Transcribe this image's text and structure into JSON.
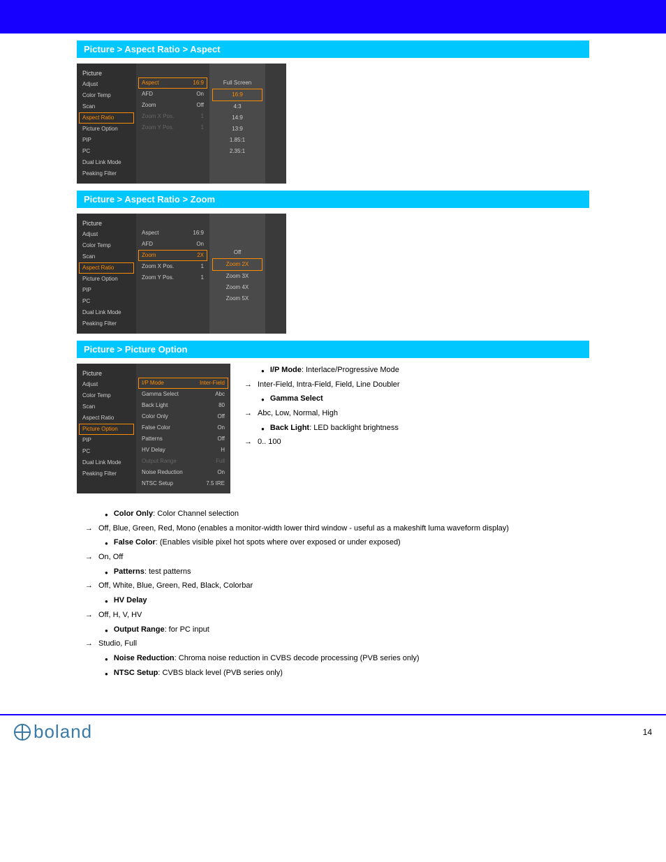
{
  "sections": {
    "aspect": {
      "title": "Picture > Aspect Ratio > Aspect",
      "menu_header": "Picture",
      "col1": [
        {
          "label": "Adjust"
        },
        {
          "label": "Color Temp"
        },
        {
          "label": "Scan"
        },
        {
          "label": "Aspect Ratio",
          "selected": true,
          "highlight": true
        },
        {
          "label": "Picture Option"
        },
        {
          "label": "PIP"
        },
        {
          "label": "PC"
        },
        {
          "label": "Dual Link Mode"
        },
        {
          "label": "Peaking Filter"
        }
      ],
      "col2": [
        {
          "label": "Aspect",
          "value": "16:9",
          "selected": true,
          "highlight": true
        },
        {
          "label": "AFD",
          "value": "On"
        },
        {
          "label": "Zoom",
          "value": "Off"
        },
        {
          "label": "Zoom X Pos.",
          "value": "1",
          "disabled": true
        },
        {
          "label": "Zoom Y Pos.",
          "value": "1",
          "disabled": true
        }
      ],
      "col3": [
        {
          "label": "Full Screen"
        },
        {
          "label": "16:9",
          "selected": true
        },
        {
          "label": "4:3"
        },
        {
          "label": "14:9"
        },
        {
          "label": "13:9"
        },
        {
          "label": "1.85:1"
        },
        {
          "label": "2.35:1"
        }
      ]
    },
    "zoom": {
      "title": "Picture > Aspect Ratio > Zoom",
      "menu_header": "Picture",
      "col1": [
        {
          "label": "Adjust"
        },
        {
          "label": "Color Temp"
        },
        {
          "label": "Scan"
        },
        {
          "label": "Aspect Ratio",
          "selected": true,
          "highlight": true
        },
        {
          "label": "Picture Option"
        },
        {
          "label": "PIP"
        },
        {
          "label": "PC"
        },
        {
          "label": "Dual Link Mode"
        },
        {
          "label": "Peaking Filter"
        }
      ],
      "col2": [
        {
          "label": "Aspect",
          "value": "16:9"
        },
        {
          "label": "AFD",
          "value": "On"
        },
        {
          "label": "Zoom",
          "value": "2X",
          "selected": true,
          "highlight": true
        },
        {
          "label": "Zoom X Pos.",
          "value": "1"
        },
        {
          "label": "Zoom Y Pos.",
          "value": "1"
        }
      ],
      "col3": [
        {
          "label": "Off"
        },
        {
          "label": "Zoom 2X",
          "selected": true
        },
        {
          "label": "Zoom 3X"
        },
        {
          "label": "Zoom 4X"
        },
        {
          "label": "Zoom 5X"
        }
      ]
    },
    "picopt": {
      "title": "Picture > Picture Option",
      "menu_header": "Picture",
      "col1": [
        {
          "label": "Adjust"
        },
        {
          "label": "Color Temp"
        },
        {
          "label": "Scan"
        },
        {
          "label": "Aspect Ratio"
        },
        {
          "label": "Picture Option",
          "selected": true,
          "highlight": true
        },
        {
          "label": "PIP"
        },
        {
          "label": "PC"
        },
        {
          "label": "Dual Link Mode"
        },
        {
          "label": "Peaking Filter"
        }
      ],
      "col2": [
        {
          "label": "I/P Mode",
          "value": "Inter-Field",
          "selected": true,
          "highlight": true
        },
        {
          "label": "Gamma Select",
          "value": "Abc"
        },
        {
          "label": "Back Light",
          "value": "80"
        },
        {
          "label": "Color Only",
          "value": "Off"
        },
        {
          "label": "False Color",
          "value": "On"
        },
        {
          "label": "Patterns",
          "value": "Off"
        },
        {
          "label": "HV Delay",
          "value": "H"
        },
        {
          "label": "Output Range",
          "value": "Full",
          "disabled": true
        },
        {
          "label": "Noise Reduction",
          "value": "On"
        },
        {
          "label": "NTSC Setup",
          "value": "7.5 IRE"
        }
      ],
      "side_bullets": [
        {
          "bold": "I/P Mode",
          "tail": ": Interlace/Progressive Mode"
        },
        {
          "arrow": true,
          "text": "Inter-Field, Intra-Field, Field, Line Doubler"
        },
        {
          "bold": "Gamma Select"
        },
        {
          "arrow": true,
          "text": "Abc, Low, Normal, High"
        },
        {
          "bold": "Back Light",
          "tail": ": LED backlight brightness"
        },
        {
          "arrow": true,
          "text": "0.. 100"
        }
      ],
      "below_bullets": [
        {
          "bold": "Color Only",
          "tail": ": Color Channel selection"
        },
        {
          "arrow": true,
          "text": "Off, Blue, Green, Red, Mono (enables a monitor-width lower third window - useful as a makeshift luma waveform display)"
        },
        {
          "bold": "False Color",
          "tail": ": (Enables visible pixel hot spots where over exposed or under exposed)"
        },
        {
          "arrow": true,
          "text": "On, Off"
        },
        {
          "bold": "Patterns",
          "tail": ": test patterns"
        },
        {
          "arrow": true,
          "text": "Off, White, Blue, Green, Red, Black, Colorbar"
        },
        {
          "bold": "HV Delay"
        },
        {
          "arrow": true,
          "text": "Off, H, V, HV"
        },
        {
          "bold": "Output Range",
          "tail": ": for PC input"
        },
        {
          "arrow": true,
          "text": "Studio, Full"
        },
        {
          "bold": "Noise Reduction",
          "tail": ": Chroma noise reduction in CVBS decode processing (PVB series only)",
          "noarrow": true
        },
        {
          "bold": "NTSC Setup",
          "tail": ": CVBS black level (PVB series only)",
          "noarrow": true
        }
      ]
    }
  },
  "footer": {
    "brand": "boland",
    "page": "14"
  }
}
